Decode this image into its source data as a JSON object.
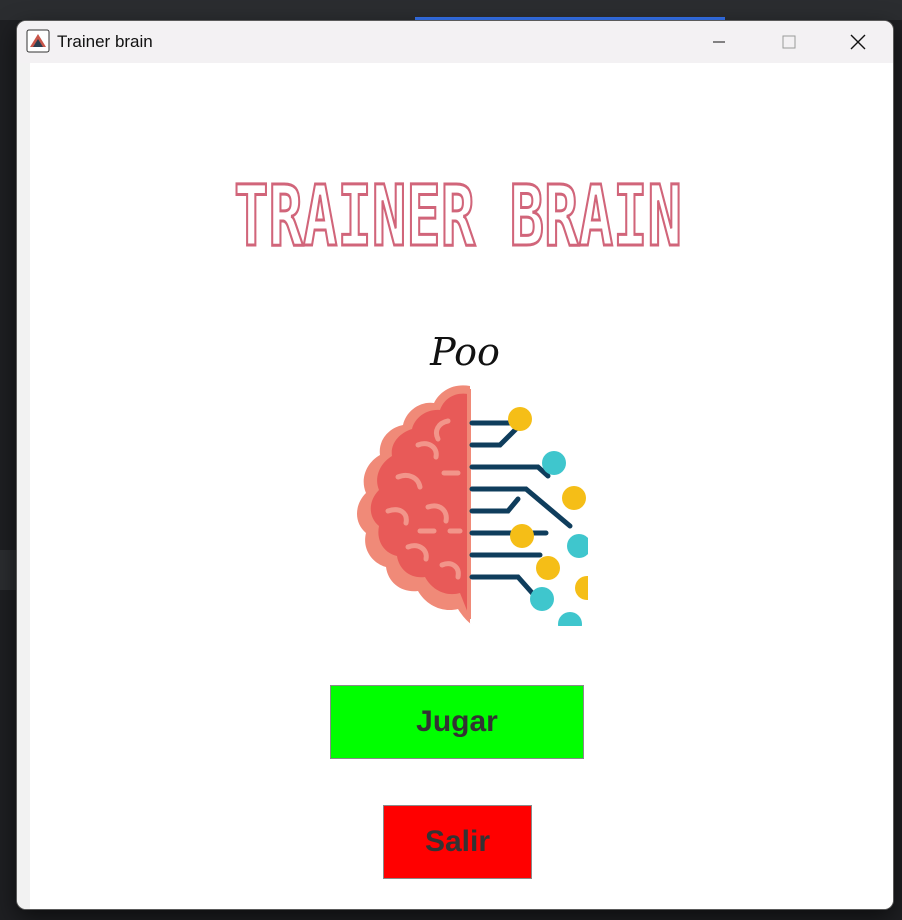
{
  "window": {
    "title": "Trainer brain",
    "controls": {
      "minimize": "minimize-icon",
      "maximize": "maximize-icon",
      "close": "close-icon"
    }
  },
  "logo": {
    "title": "TRAINER BRAIN",
    "subtitle": "Poo",
    "brain_icon": "brain-circuit-icon"
  },
  "buttons": {
    "play_label": "Jugar",
    "exit_label": "Salir"
  },
  "colors": {
    "play_button": "#00ff00",
    "exit_button": "#ff0000",
    "logo_pink": "#d1657a",
    "brain_red": "#e85a58",
    "circuit_yellow": "#f5be17",
    "circuit_cyan": "#3fc6cd",
    "circuit_navy": "#0f3d5c"
  }
}
